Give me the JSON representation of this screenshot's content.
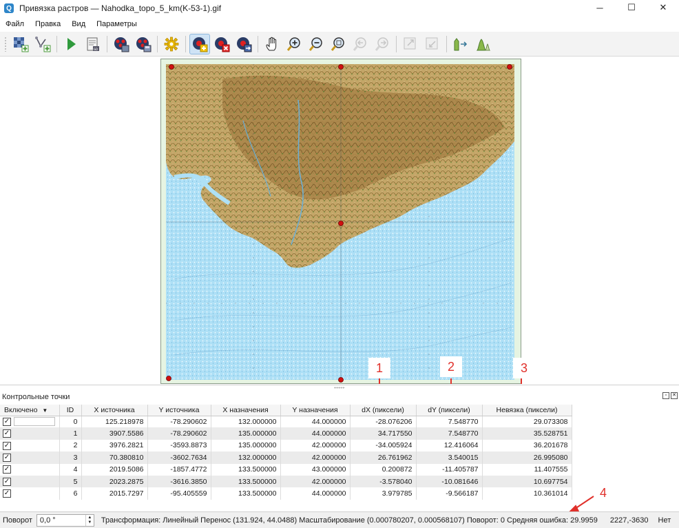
{
  "window": {
    "title": "Привязка растров — Nahodka_topo_5_km(K-53-1).gif",
    "app_icon": "Q",
    "minimize_label": "─",
    "maximize_label": "☐",
    "close_label": "✕"
  },
  "menu": [
    "Файл",
    "Правка",
    "Вид",
    "Параметры"
  ],
  "toolbar": {
    "buttons": [
      "open-raster-icon",
      "start-georef-icon",
      "run-icon",
      "generate-script-icon",
      "load-gcp-icon",
      "save-gcp-icon",
      "settings-icon",
      "add-point-icon",
      "delete-point-icon",
      "move-point-icon",
      "pan-icon",
      "zoom-in-icon",
      "zoom-out-icon",
      "zoom-layer-icon",
      "zoom-last-icon",
      "zoom-next-icon",
      "link-georef-icon",
      "link-qgis-icon",
      "full-histogram-icon",
      "local-histogram-icon"
    ],
    "active_button": "add-point-icon"
  },
  "annotations": [
    "1",
    "2",
    "3",
    "4"
  ],
  "colors": {
    "accent_red": "#e0302a",
    "sea": "#a8dcf5",
    "land": "#b89a5e",
    "frame": "#e2f2e0",
    "gcp_marker": "#d01010"
  },
  "gcp_panel": {
    "title": "Контрольные точки",
    "columns": [
      "Включено",
      "ID",
      "X источника",
      "Y источника",
      "X назначения",
      "Y назначения",
      "dX (пиксели)",
      "dY (пиксели)",
      "Невязка (пиксели)"
    ],
    "rows": [
      {
        "enabled": "✓",
        "id": "0",
        "x_src": "125.218978",
        "y_src": "-78.290602",
        "x_dst": "132.000000",
        "y_dst": "44.000000",
        "dx": "-28.076206",
        "dy": "7.548770",
        "res": "29.073308"
      },
      {
        "enabled": "✓",
        "id": "1",
        "x_src": "3907.5586",
        "y_src": "-78.290602",
        "x_dst": "135.000000",
        "y_dst": "44.000000",
        "dx": "34.717550",
        "dy": "7.548770",
        "res": "35.528751"
      },
      {
        "enabled": "✓",
        "id": "2",
        "x_src": "3976.2821",
        "y_src": "-3593.8873",
        "x_dst": "135.000000",
        "y_dst": "42.000000",
        "dx": "-34.005924",
        "dy": "12.416064",
        "res": "36.201678"
      },
      {
        "enabled": "✓",
        "id": "3",
        "x_src": "70.380810",
        "y_src": "-3602.7634",
        "x_dst": "132.000000",
        "y_dst": "42.000000",
        "dx": "26.761962",
        "dy": "3.540015",
        "res": "26.995080"
      },
      {
        "enabled": "✓",
        "id": "4",
        "x_src": "2019.5086",
        "y_src": "-1857.4772",
        "x_dst": "133.500000",
        "y_dst": "43.000000",
        "dx": "0.200872",
        "dy": "-11.405787",
        "res": "11.407555"
      },
      {
        "enabled": "✓",
        "id": "5",
        "x_src": "2023.2875",
        "y_src": "-3616.3850",
        "x_dst": "133.500000",
        "y_dst": "42.000000",
        "dx": "-3.578040",
        "dy": "-10.081646",
        "res": "10.697754"
      },
      {
        "enabled": "✓",
        "id": "6",
        "x_src": "2015.7297",
        "y_src": "-95.405559",
        "x_dst": "133.500000",
        "y_dst": "44.000000",
        "dx": "3.979785",
        "dy": "-9.566187",
        "res": "10.361014"
      }
    ]
  },
  "status": {
    "rotation_label": "Поворот",
    "rotation_value": "0,0 °",
    "transform_text": "Трансформация: Линейный Перенос (131.924, 44.0488) Масштабирование (0.000780207, 0.000568107) Поворот: 0 Средняя ошибка: 29.9959",
    "coords": "2227,-3630",
    "crs": "Нет"
  }
}
